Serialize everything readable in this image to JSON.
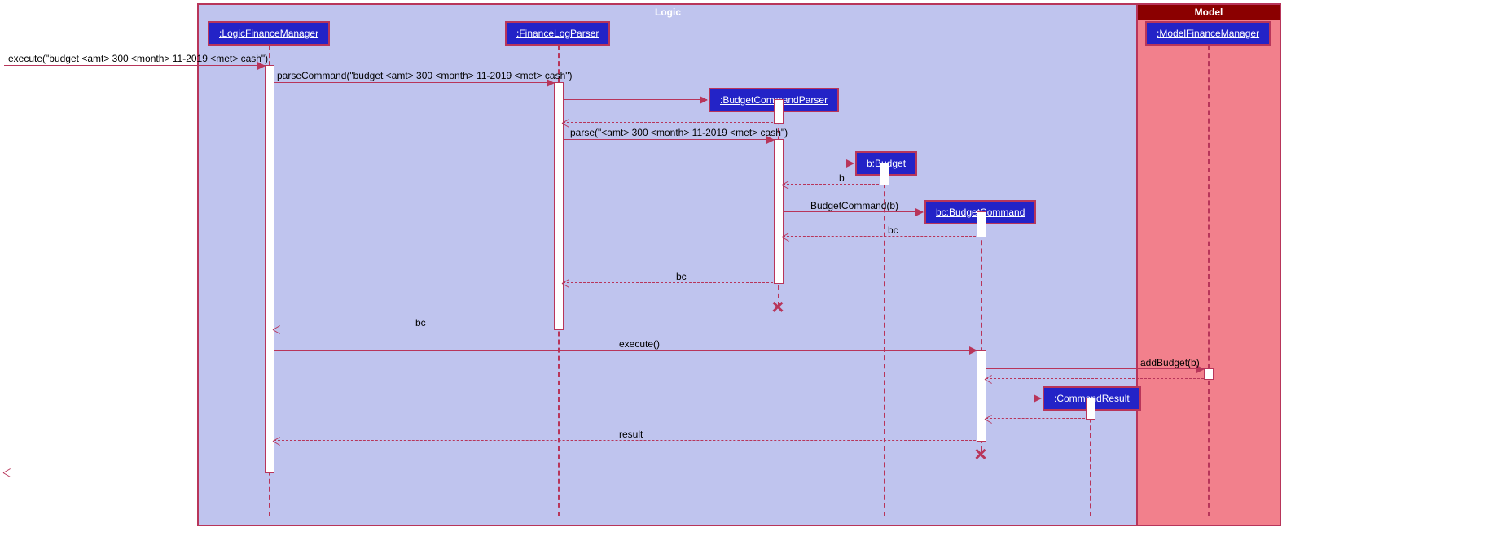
{
  "chart_data": {
    "type": "sequence",
    "frames": [
      {
        "name": "Logic"
      },
      {
        "name": "Model"
      }
    ],
    "participants": [
      {
        "id": "lfm",
        "label": ":LogicFinanceManager",
        "frame": "Logic"
      },
      {
        "id": "flp",
        "label": ":FinanceLogParser",
        "frame": "Logic"
      },
      {
        "id": "bcp",
        "label": ":BudgetCommandParser",
        "frame": "Logic"
      },
      {
        "id": "budget",
        "label": "b:Budget",
        "frame": "Logic"
      },
      {
        "id": "bc",
        "label": "bc:BudgetCommand",
        "frame": "Logic"
      },
      {
        "id": "cr",
        "label": ":CommandResult",
        "frame": "Logic"
      },
      {
        "id": "mfm",
        "label": ":ModelFinanceManager",
        "frame": "Model"
      }
    ],
    "messages": [
      {
        "from": "external",
        "to": "lfm",
        "label": "execute(\"budget <amt> 300 <month> 11-2019 <met> cash\")",
        "type": "sync"
      },
      {
        "from": "lfm",
        "to": "flp",
        "label": "parseCommand(\"budget <amt> 300 <month> 11-2019 <met> cash\")",
        "type": "sync"
      },
      {
        "from": "flp",
        "to": "bcp",
        "label": "",
        "type": "create"
      },
      {
        "from": "bcp",
        "to": "flp",
        "label": "",
        "type": "return"
      },
      {
        "from": "flp",
        "to": "bcp",
        "label": "parse(\"<amt> 300 <month> 11-2019 <met> cash\")",
        "type": "sync"
      },
      {
        "from": "bcp",
        "to": "budget",
        "label": "",
        "type": "create"
      },
      {
        "from": "budget",
        "to": "bcp",
        "label": "b",
        "type": "return"
      },
      {
        "from": "bcp",
        "to": "bc",
        "label": "BudgetCommand(b)",
        "type": "create"
      },
      {
        "from": "bc",
        "to": "bcp",
        "label": "bc",
        "type": "return"
      },
      {
        "from": "bcp",
        "to": "flp",
        "label": "bc",
        "type": "return"
      },
      {
        "from": "bcp",
        "to": null,
        "label": "",
        "type": "destroy"
      },
      {
        "from": "flp",
        "to": "lfm",
        "label": "bc",
        "type": "return"
      },
      {
        "from": "lfm",
        "to": "bc",
        "label": "execute()",
        "type": "sync"
      },
      {
        "from": "bc",
        "to": "mfm",
        "label": "addBudget(b)",
        "type": "sync"
      },
      {
        "from": "mfm",
        "to": "bc",
        "label": "",
        "type": "return"
      },
      {
        "from": "bc",
        "to": "cr",
        "label": "",
        "type": "create"
      },
      {
        "from": "cr",
        "to": "bc",
        "label": "",
        "type": "return"
      },
      {
        "from": "bc",
        "to": "lfm",
        "label": "result",
        "type": "return"
      },
      {
        "from": "bc",
        "to": null,
        "label": "",
        "type": "destroy"
      },
      {
        "from": "lfm",
        "to": "external",
        "label": "",
        "type": "return"
      }
    ]
  },
  "frames": {
    "logic": "Logic",
    "model": "Model"
  },
  "participants": {
    "lfm": ":LogicFinanceManager",
    "flp": ":FinanceLogParser",
    "bcp": ":BudgetCommandParser",
    "budget": "b:Budget",
    "bc": "bc:BudgetCommand",
    "cr": ":CommandResult",
    "mfm": ":ModelFinanceManager"
  },
  "messages": {
    "m1": "execute(\"budget <amt> 300 <month> 11-2019 <met> cash\")",
    "m2": "parseCommand(\"budget <amt> 300 <month> 11-2019 <met> cash\")",
    "m5": "parse(\"<amt> 300 <month> 11-2019 <met> cash\")",
    "m7": "b",
    "m8": "BudgetCommand(b)",
    "m9": "bc",
    "m10": "bc",
    "m12": "bc",
    "m13": "execute()",
    "m14": "addBudget(b)",
    "m18": "result"
  }
}
